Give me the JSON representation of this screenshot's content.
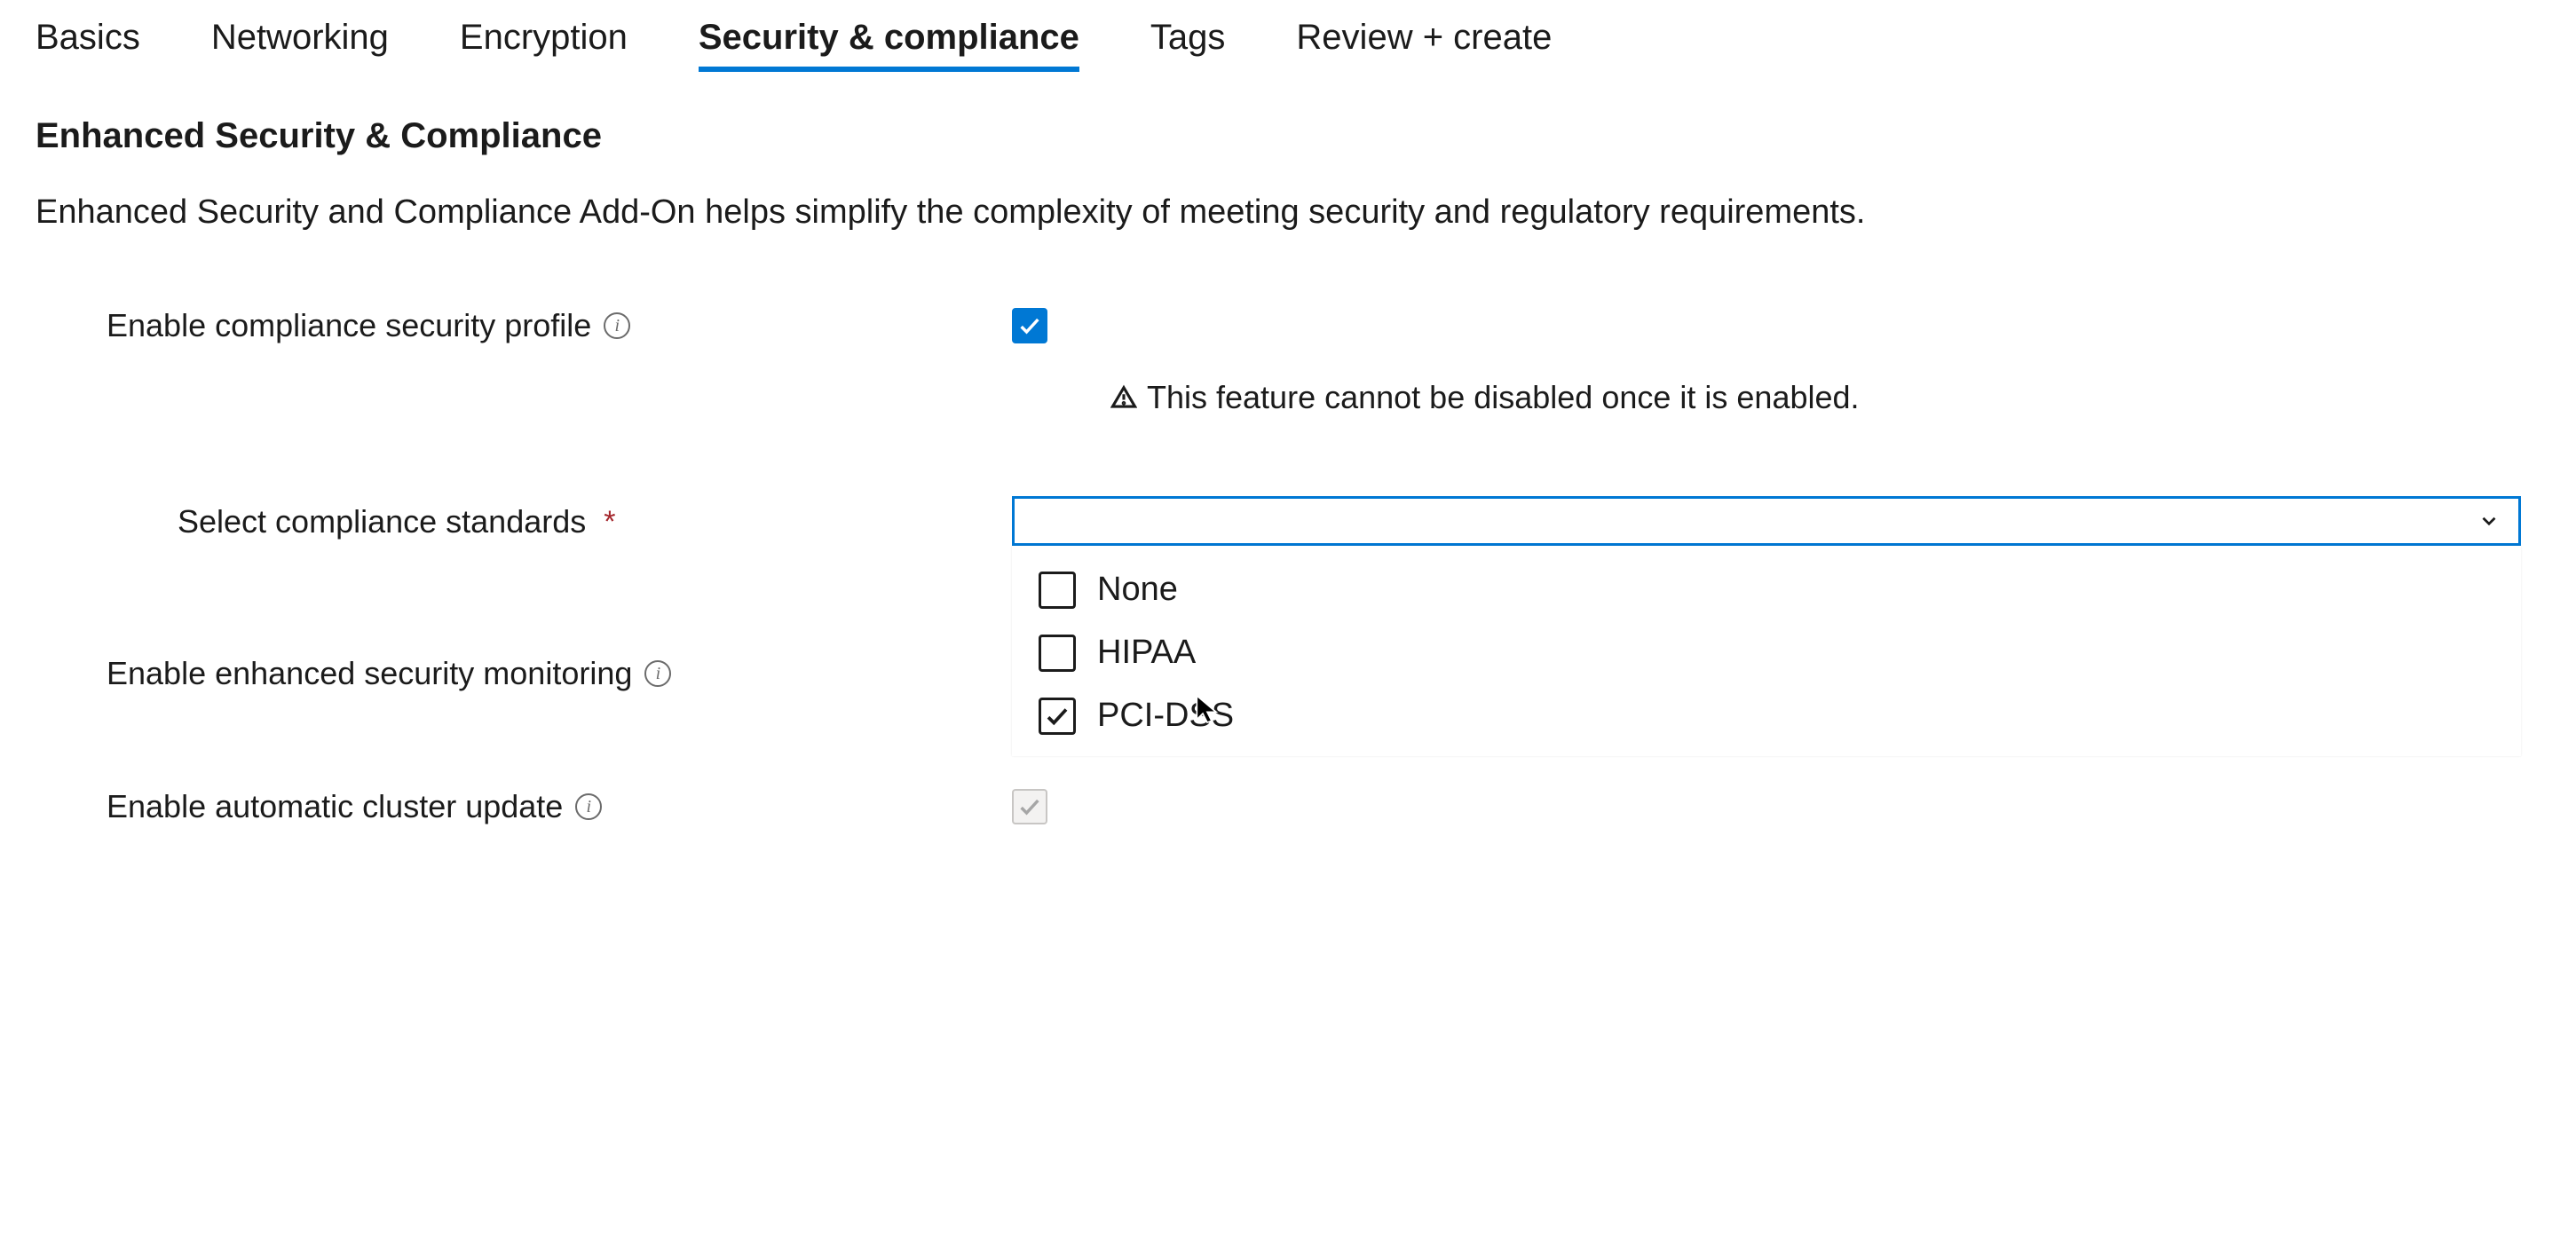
{
  "tabs": [
    {
      "label": "Basics",
      "active": false
    },
    {
      "label": "Networking",
      "active": false
    },
    {
      "label": "Encryption",
      "active": false
    },
    {
      "label": "Security & compliance",
      "active": true
    },
    {
      "label": "Tags",
      "active": false
    },
    {
      "label": "Review + create",
      "active": false
    }
  ],
  "section": {
    "title": "Enhanced Security & Compliance",
    "description": "Enhanced Security and Compliance Add-On helps simplify the complexity of meeting security and regulatory requirements."
  },
  "fields": {
    "enable_profile": {
      "label": "Enable compliance security profile",
      "checked": true,
      "warning": "This feature cannot be disabled once it is enabled."
    },
    "compliance_standards": {
      "label": "Select compliance standards",
      "required": true,
      "options": [
        {
          "label": "None",
          "checked": false
        },
        {
          "label": "HIPAA",
          "checked": false
        },
        {
          "label": "PCI-DSS",
          "checked": true
        }
      ]
    },
    "enhanced_monitoring": {
      "label": "Enable enhanced security monitoring",
      "checked": true,
      "disabled": true
    },
    "auto_update": {
      "label": "Enable automatic cluster update",
      "checked": true,
      "disabled": true
    }
  },
  "colors": {
    "accent": "#0078d4",
    "required": "#a4262c"
  }
}
